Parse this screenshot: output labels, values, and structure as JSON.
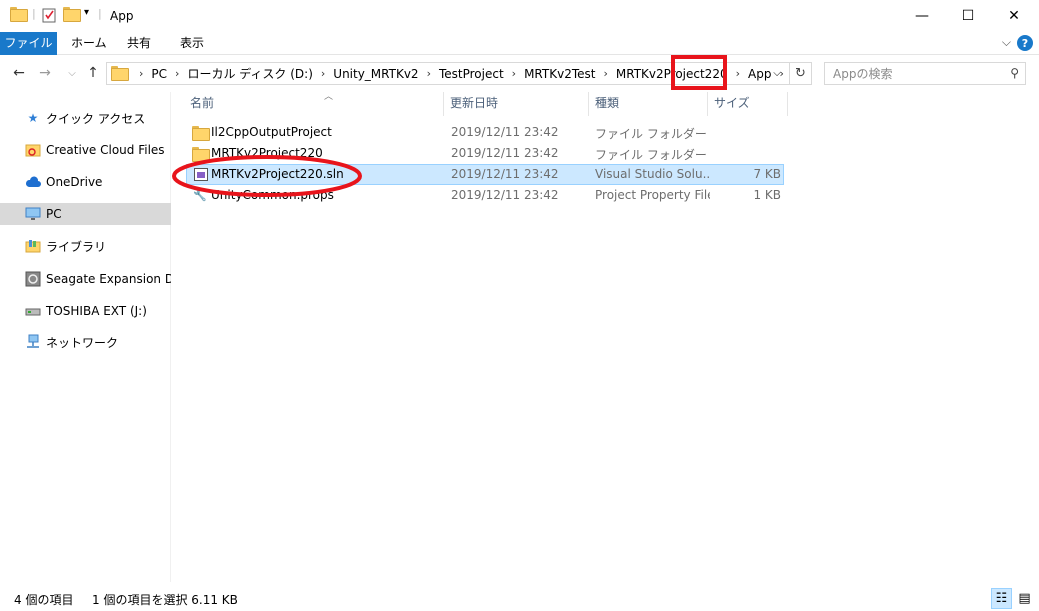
{
  "window": {
    "title": "App",
    "minimize": "—",
    "maximize": "☐",
    "close": "✕"
  },
  "ribbon": {
    "tabs": [
      {
        "label": "ファイル"
      },
      {
        "label": "ホーム"
      },
      {
        "label": "共有"
      },
      {
        "label": "表示"
      }
    ],
    "collapse": "⌵",
    "help": "?"
  },
  "address": {
    "crumbs": [
      "PC",
      "ローカル ディスク (D:)",
      "Unity_MRTKv2",
      "TestProject",
      "MRTKv2Test",
      "MRTKv2Project220",
      "App"
    ],
    "search_placeholder": "Appの検索"
  },
  "sidebar": {
    "items": [
      {
        "label": "クイック アクセス",
        "icon": "star-icon"
      },
      {
        "label": "Creative Cloud Files",
        "icon": "creative-cloud-icon"
      },
      {
        "label": "OneDrive",
        "icon": "cloud-icon"
      },
      {
        "label": "PC",
        "icon": "monitor-icon"
      },
      {
        "label": "ライブラリ",
        "icon": "library-icon"
      },
      {
        "label": "Seagate Expansion Drive",
        "icon": "drive-icon"
      },
      {
        "label": "TOSHIBA EXT (J:)",
        "icon": "usb-drive-icon"
      },
      {
        "label": "ネットワーク",
        "icon": "network-icon"
      }
    ],
    "selected": "PC"
  },
  "columns": {
    "name": "名前",
    "modified": "更新日時",
    "type": "種類",
    "size": "サイズ"
  },
  "files": [
    {
      "name": "Il2CppOutputProject",
      "modified": "2019/12/11 23:42",
      "type": "ファイル フォルダー",
      "size": "",
      "icon": "folder-icon"
    },
    {
      "name": "MRTKv2Project220",
      "modified": "2019/12/11 23:42",
      "type": "ファイル フォルダー",
      "size": "",
      "icon": "folder-icon"
    },
    {
      "name": "MRTKv2Project220.sln",
      "modified": "2019/12/11 23:42",
      "type": "Visual Studio Solu...",
      "size": "7 KB",
      "icon": "visual-studio-solution-icon",
      "selected": true
    },
    {
      "name": "UnityCommon.props",
      "modified": "2019/12/11 23:42",
      "type": "Project Property File",
      "size": "1 KB",
      "icon": "wrench-icon"
    }
  ],
  "status": {
    "count": "4 個の項目",
    "selection": "1 個の項目を選択  6.11 KB"
  },
  "colors": {
    "accent": "#1979ca",
    "selection_bg": "#cce8ff",
    "annotation_red": "#e8141b"
  }
}
